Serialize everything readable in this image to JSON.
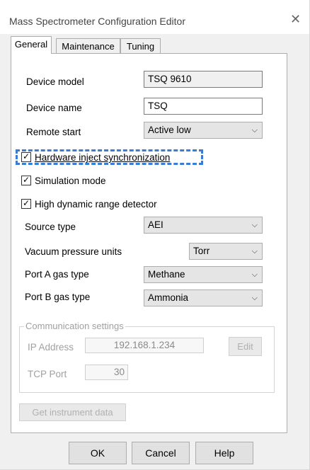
{
  "window": {
    "title": "Mass Spectrometer Configuration Editor",
    "close_glyph": "✕"
  },
  "tabs": [
    {
      "label": "General",
      "active": true
    },
    {
      "label": "Maintenance",
      "active": false
    },
    {
      "label": "Tuning",
      "active": false
    }
  ],
  "general": {
    "device_model": {
      "label": "Device model",
      "value": "TSQ 9610"
    },
    "device_name": {
      "label": "Device name",
      "value": "TSQ"
    },
    "remote_start": {
      "label": "Remote start",
      "value": "Active low"
    },
    "hardware_inject_sync": {
      "label": "Hardware inject synchronization",
      "checked": true
    },
    "simulation_mode": {
      "label": "Simulation mode",
      "checked": true
    },
    "high_dynamic_range": {
      "label": "High dynamic range detector",
      "checked": true
    },
    "source_type": {
      "label": "Source type",
      "value": "AEI"
    },
    "vacuum_units": {
      "label": "Vacuum pressure units",
      "value": "Torr"
    },
    "port_a_gas": {
      "label": "Port A gas type",
      "value": "Methane"
    },
    "port_b_gas": {
      "label": "Port B gas type",
      "value": "Ammonia"
    }
  },
  "communication": {
    "title": "Communication settings",
    "ip_label": "IP Address",
    "ip_value": "192.168.1.234",
    "edit_label": "Edit",
    "tcp_label": "TCP Port",
    "tcp_value": "30"
  },
  "get_instrument_data": "Get instrument data",
  "buttons": {
    "ok": "OK",
    "cancel": "Cancel",
    "help": "Help"
  },
  "icons": {
    "dropdown": "chevron-down-icon",
    "checkbox": "checkmark-icon"
  }
}
